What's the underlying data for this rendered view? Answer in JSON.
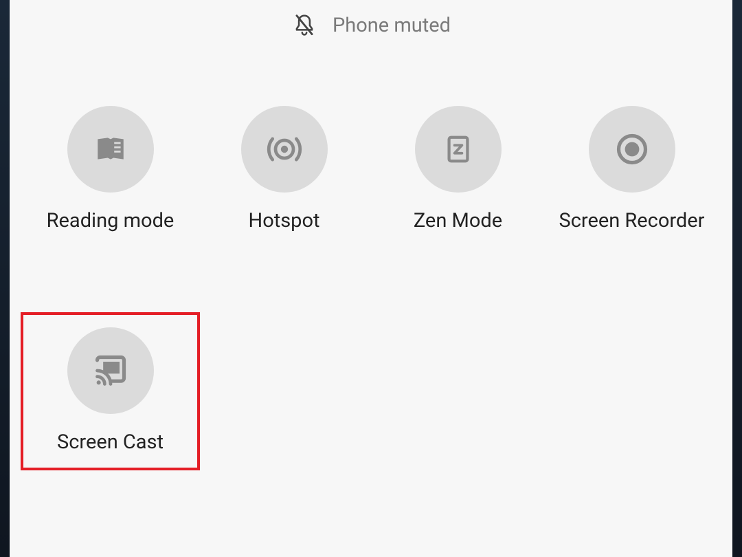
{
  "status": {
    "text": "Phone muted",
    "icon": "bell-muted-icon"
  },
  "tiles": [
    {
      "label": "Reading mode",
      "icon": "reading-mode-icon",
      "highlighted": false
    },
    {
      "label": "Hotspot",
      "icon": "hotspot-icon",
      "highlighted": false
    },
    {
      "label": "Zen Mode",
      "icon": "zen-mode-icon",
      "highlighted": false
    },
    {
      "label": "Screen Recorder",
      "icon": "screen-recorder-icon",
      "highlighted": false
    },
    {
      "label": "Screen Cast",
      "icon": "screen-cast-icon",
      "highlighted": true
    }
  ]
}
